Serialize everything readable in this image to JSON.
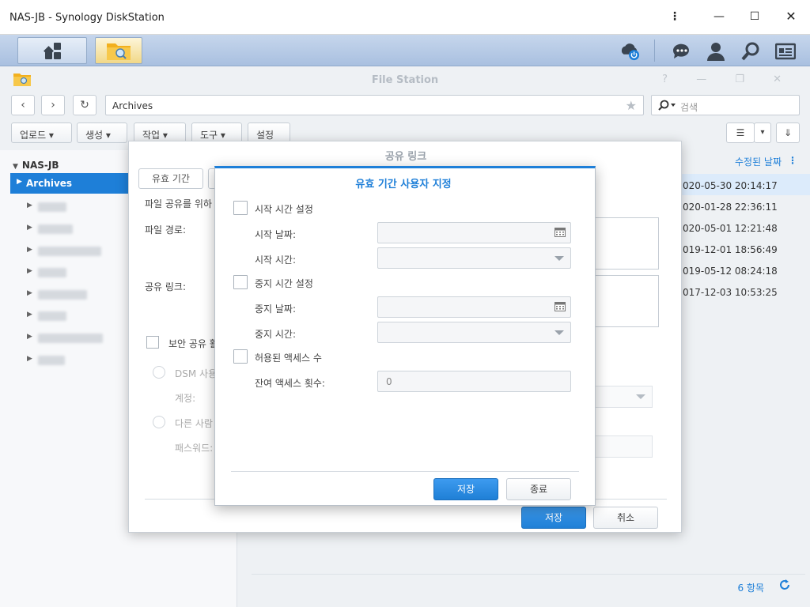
{
  "window": {
    "title": "NAS-JB - Synology DiskStation",
    "menu_glyph": "⋮",
    "min_glyph": "—",
    "max_glyph": "☐",
    "close_glyph": "✕"
  },
  "colors": {
    "accent": "#1e7fd8",
    "selection": "#dcebfb",
    "taskbar": "#b6cae6"
  },
  "file_station": {
    "title": "File Station",
    "header_controls": "? — ❐ ✕",
    "nav": {
      "back": "‹",
      "forward": "›",
      "refresh": "↻"
    },
    "path": "Archives",
    "search_placeholder": "검색",
    "toolbar": {
      "upload": "업로드 ▾",
      "create": "생성 ▾",
      "action": "작업 ▾",
      "tools": "도구 ▾",
      "settings": "설정"
    },
    "view": {
      "list": "☰",
      "dropdown": "▾",
      "sort": "⇓"
    }
  },
  "sidebar": {
    "root": "NAS-JB",
    "selected": "Archives"
  },
  "list": {
    "column_modified": "수정된 날짜",
    "more": "⋮",
    "rows": [
      "020-05-30 20:14:17",
      "020-01-28 22:36:11",
      "020-05-01 12:21:48",
      "019-12-01 18:56:49",
      "019-05-12 08:24:18",
      "017-12-03 10:53:25"
    ],
    "count": "6 항목"
  },
  "share_dialog": {
    "title": "공유 링크",
    "tab_validity": "유효 기간",
    "desc": "파일 공유를 위하",
    "file_path_label": "파일 경로:",
    "share_link_label": "공유 링크:",
    "secure_share": "보안 공유 활",
    "dsm_user": "DSM 사용",
    "account": "계정:",
    "others": "다른 사람",
    "password": "패스워드:",
    "save": "저장",
    "cancel": "취소"
  },
  "validity_dialog": {
    "title": "유효 기간 사용자 지정",
    "start_time_setting": "시작 시간 설정",
    "start_date_label": "시작 날짜:",
    "start_time_label": "시작 시간:",
    "stop_time_setting": "중지 시간 설정",
    "stop_date_label": "중지 날짜:",
    "stop_time_label": "중지 시간:",
    "allowed_access": "허용된 액세스 수",
    "remaining_label": "잔여 액세스 횟수:",
    "remaining_value": "0",
    "save": "저장",
    "close": "종료"
  }
}
